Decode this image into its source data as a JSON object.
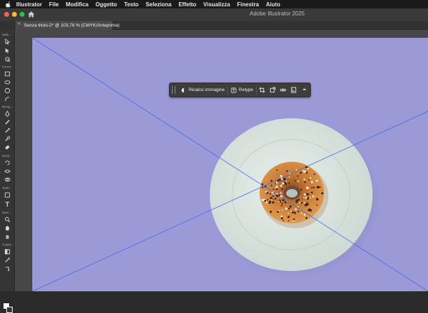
{
  "menubar": {
    "items": [
      "Illustrator",
      "File",
      "Modifica",
      "Oggetto",
      "Testo",
      "Seleziona",
      "Effetto",
      "Visualizza",
      "Finestra",
      "Aiuto"
    ]
  },
  "window": {
    "title": "Adobe Illustrator 2025"
  },
  "document_tab": {
    "close_glyph": "×",
    "label": "Senza titolo-2* @ 103,76 % (CMYK/Anteprima)"
  },
  "tools": {
    "groups": [
      "Sele...",
      "Forme",
      "Diseg...",
      "Modi...",
      "Testo",
      "Navi...",
      "Colore"
    ]
  },
  "taskbar": {
    "trace_label": "Ricalco immagine",
    "retype_label": "Retype",
    "icons": [
      "crop-icon",
      "place-icon",
      "link-icon",
      "embed-icon",
      "more-icon"
    ],
    "more_glyph": "•••"
  },
  "colors": {
    "canvas_bg": "#9c9ad6",
    "plate": "#d9e2dd",
    "donut": "#d48a42",
    "selection_line": "#3f6df2"
  }
}
